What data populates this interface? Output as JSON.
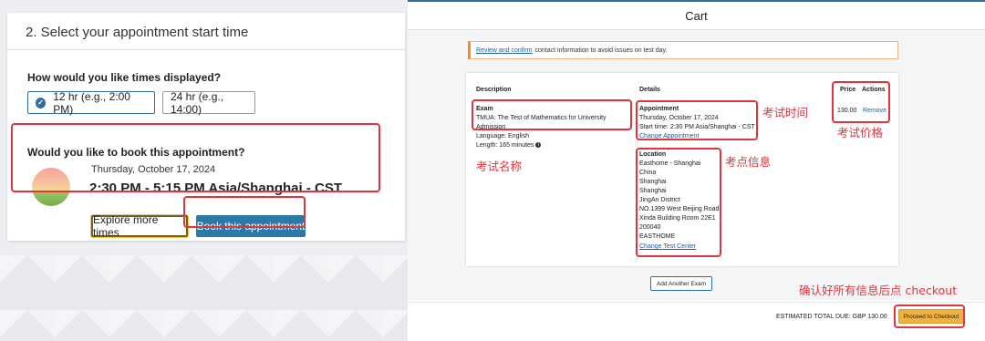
{
  "left_panel": {
    "step_title": "2. Select your appointment start time",
    "times_question": "How would you like times displayed?",
    "format_12": "12 hr (e.g., 2:00 PM)",
    "format_24": "24 hr (e.g., 14:00)",
    "book_question": "Would you like to book this appointment?",
    "appointment_date": "Thursday, October 17, 2024",
    "appointment_time": "2:30 PM - 5:15 PM Asia/Shanghai - CST",
    "explore_label": "Explore more times",
    "book_label": "Book this appointment",
    "selected_format": "12 hr"
  },
  "cart": {
    "title": "Cart",
    "notice_link": "Review and confirm",
    "notice_text": "contact information to avoid issues on test day.",
    "headers": {
      "description": "Description",
      "details": "Details",
      "price": "Price",
      "actions": "Actions"
    },
    "exam": {
      "heading": "Exam",
      "name": "TMUA: The Test of Mathematics for University Admission",
      "language": "Language: English",
      "length": "Length: 165 minutes"
    },
    "appointment": {
      "heading": "Appointment",
      "date": "Thursday, October 17, 2024",
      "start_time": "Start time: 2:30 PM Asia/Shanghai - CST",
      "change_link": "Change Appointment"
    },
    "location": {
      "heading": "Location",
      "lines": [
        "Easthome - Shanghai",
        "China",
        "Shanghai",
        "Shanghai",
        "JingAn District",
        "NO.1399 West Beijing Road",
        "Xinda Building Room 22E1",
        "200040",
        "EASTHOME"
      ],
      "change_link": "Change Test Center"
    },
    "price": "130.00",
    "remove_label": "Remove",
    "add_exam_label": "Add Another Exam",
    "estimated_total": "ESTIMATED TOTAL DUE: GBP 130.00",
    "checkout_label": "Proceed to Checkout"
  },
  "annotations": {
    "exam_time": "考试时间",
    "exam_price": "考试价格",
    "exam_name": "考试名称",
    "test_center": "考点信息",
    "confirm_checkout": "确认好所有信息后点 checkout"
  },
  "colors": {
    "accent_blue": "#2b7aa6",
    "annotation_red": "#e0353c",
    "checkout_yellow": "#f2b13d",
    "notice_orange": "#f08a2c"
  }
}
